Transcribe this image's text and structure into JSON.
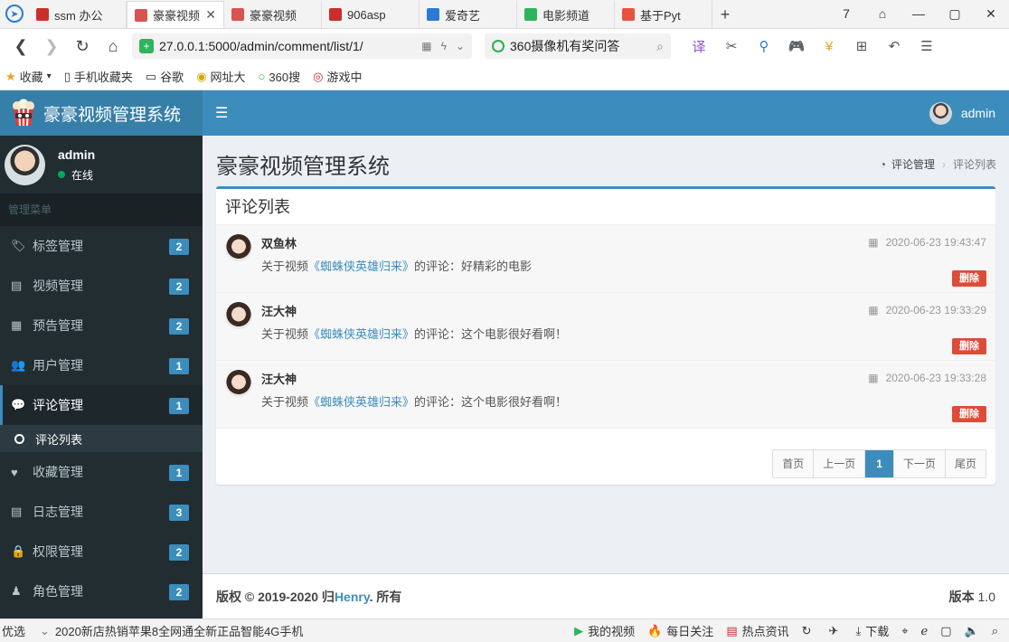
{
  "browser": {
    "tabs": [
      {
        "title": "ssm 办公",
        "color": "#c9302c",
        "active": false
      },
      {
        "title": "豪豪视频",
        "color": "#d9534f",
        "active": true
      },
      {
        "title": "豪豪视频",
        "color": "#d9534f",
        "active": false
      },
      {
        "title": "906asp",
        "color": "#c9302c",
        "active": false
      },
      {
        "title": "爱奇艺",
        "color": "#2b7bd6",
        "active": false
      },
      {
        "title": "电影频道",
        "color": "#2fb35d",
        "active": false
      },
      {
        "title": "基于Pyt",
        "color": "#e5533d",
        "active": false
      }
    ],
    "new_tab": "+",
    "address": "27.0.0.1:5000/admin/comment/list/1/",
    "search_text": "360摄像机有奖问答",
    "bookmarks": [
      {
        "label": "收藏",
        "icon": "★"
      },
      {
        "label": "手机收藏夹",
        "icon": "▯"
      },
      {
        "label": "谷歌",
        "icon": "▭"
      },
      {
        "label": "网址大",
        "icon": "◉"
      },
      {
        "label": "360搜",
        "icon": "○"
      },
      {
        "label": "游戏中",
        "icon": "◎"
      }
    ],
    "win_controls": [
      "7",
      "⌂",
      "—",
      "▢",
      "✕"
    ]
  },
  "app": {
    "logo_text": "豪豪视频管理系统",
    "header_user": "admin"
  },
  "sidebar": {
    "user_name": "admin",
    "user_status": "在线",
    "menu_header": "管理菜单",
    "items": [
      {
        "label": "标签管理",
        "icon": "🏷",
        "badge": "2"
      },
      {
        "label": "视频管理",
        "icon": "▤",
        "badge": "2"
      },
      {
        "label": "预告管理",
        "icon": "▦",
        "badge": "2"
      },
      {
        "label": "用户管理",
        "icon": "👥",
        "badge": "1"
      },
      {
        "label": "评论管理",
        "icon": "💬",
        "badge": "1"
      },
      {
        "label": "收藏管理",
        "icon": "♥",
        "badge": "1"
      },
      {
        "label": "日志管理",
        "icon": "▤",
        "badge": "3"
      },
      {
        "label": "权限管理",
        "icon": "🔒",
        "badge": "2"
      },
      {
        "label": "角色管理",
        "icon": "♟",
        "badge": "2"
      }
    ],
    "sub_item": "评论列表"
  },
  "page": {
    "title": "豪豪视频管理系统",
    "breadcrumb_parent": "评论管理",
    "breadcrumb_sep": "›",
    "breadcrumb_current": "评论列表",
    "box_title": "评论列表"
  },
  "comments": [
    {
      "name": "双鱼林",
      "prefix": "关于视频",
      "movie": "《蜘蛛侠英雄归来》",
      "suffix": "的评论：好精彩的电影",
      "time": "2020-06-23 19:43:47",
      "delete_label": "删除"
    },
    {
      "name": "汪大神",
      "prefix": "关于视频",
      "movie": "《蜘蛛侠英雄归来》",
      "suffix": "的评论：这个电影很好看啊！",
      "time": "2020-06-23 19:33:29",
      "delete_label": "删除"
    },
    {
      "name": "汪大神",
      "prefix": "关于视频",
      "movie": "《蜘蛛侠英雄归来》",
      "suffix": "的评论：这个电影很好看啊！",
      "time": "2020-06-23 19:33:28",
      "delete_label": "删除"
    }
  ],
  "pagination": {
    "first": "首页",
    "prev": "上一页",
    "current": "1",
    "next": "下一页",
    "last": "尾页"
  },
  "footer": {
    "copyright": "版权 © 2019-2020 归",
    "author": "Henry",
    "rights": ". 所有",
    "version_label": "版本",
    "version": "1.0"
  },
  "statusbar": {
    "left_label": "优选",
    "news": "2020新店热销苹果8全网通全新正品智能4G手机",
    "items": [
      {
        "label": "我的视频",
        "icon": "▶"
      },
      {
        "label": "每日关注",
        "icon": "🔥"
      },
      {
        "label": "热点资讯",
        "icon": "▤"
      },
      {
        "label": "",
        "icon": "↻"
      },
      {
        "label": "",
        "icon": "✈"
      },
      {
        "label": "下载",
        "icon": "⤓"
      }
    ]
  },
  "colors": {
    "header": "#3c8dbc",
    "sidebar": "#222d32",
    "danger": "#dd4b39",
    "online": "#00a65a"
  }
}
